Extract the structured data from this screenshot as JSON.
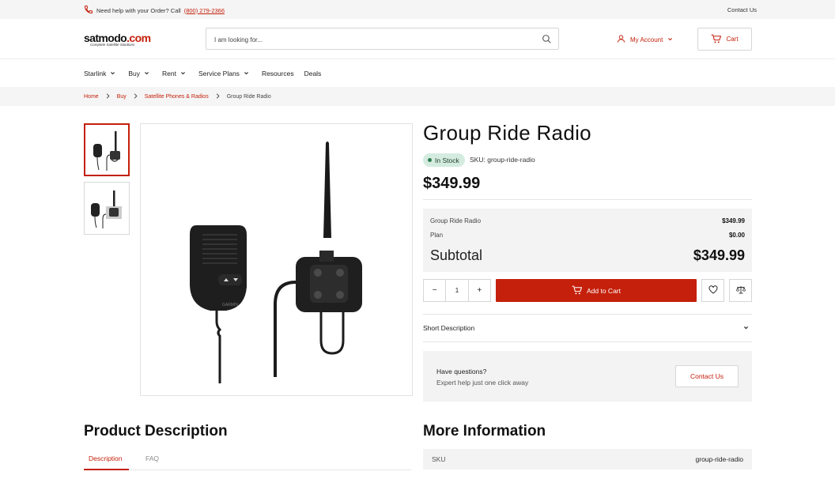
{
  "topbar": {
    "help_text": "Need help with your Order? Call",
    "phone": "(800) 279-2366",
    "contact": "Contact Us"
  },
  "header": {
    "logo_brand": "satmodo",
    "logo_dot": ".com",
    "logo_tagline": "Complete Satellite Solutions",
    "search_placeholder": "I am looking for...",
    "account_label": "My Account",
    "cart_label": "Cart"
  },
  "nav": {
    "items": [
      {
        "label": "Starlink",
        "dropdown": true
      },
      {
        "label": "Buy",
        "dropdown": true
      },
      {
        "label": "Rent",
        "dropdown": true
      },
      {
        "label": "Service Plans",
        "dropdown": true
      },
      {
        "label": "Resources",
        "dropdown": false
      },
      {
        "label": "Deals",
        "dropdown": false
      }
    ]
  },
  "breadcrumb": {
    "home": "Home",
    "buy": "Buy",
    "category": "Satellite Phones & Radios",
    "current": "Group Ride Radio"
  },
  "product": {
    "title": "Group Ride Radio",
    "stock": "In Stock",
    "sku_label": "SKU:",
    "sku": "group-ride-radio",
    "price": "$349.99",
    "thumbnails_count": 2,
    "selected_thumbnail": 1
  },
  "summary": {
    "item_label": "Group Ride Radio",
    "item_price": "$349.99",
    "plan_label": "Plan",
    "plan_price": "$0.00",
    "subtotal_label": "Subtotal",
    "subtotal_value": "$349.99"
  },
  "actions": {
    "qty_minus": "−",
    "qty_value": "1",
    "qty_plus": "+",
    "add_to_cart": "Add to Cart"
  },
  "short_description": {
    "label": "Short Description"
  },
  "questions": {
    "title": "Have questions?",
    "subtitle": "Expert help just one click away",
    "button": "Contact Us"
  },
  "product_description": {
    "heading": "Product Description",
    "tabs": [
      "Description",
      "FAQ"
    ]
  },
  "more_information": {
    "heading": "More Information",
    "rows": [
      {
        "key": "SKU",
        "value": "group-ride-radio"
      }
    ]
  },
  "colors": {
    "accent": "#c4200b",
    "stock_badge": "#d4ecdf",
    "panel": "#f3f3f3"
  }
}
